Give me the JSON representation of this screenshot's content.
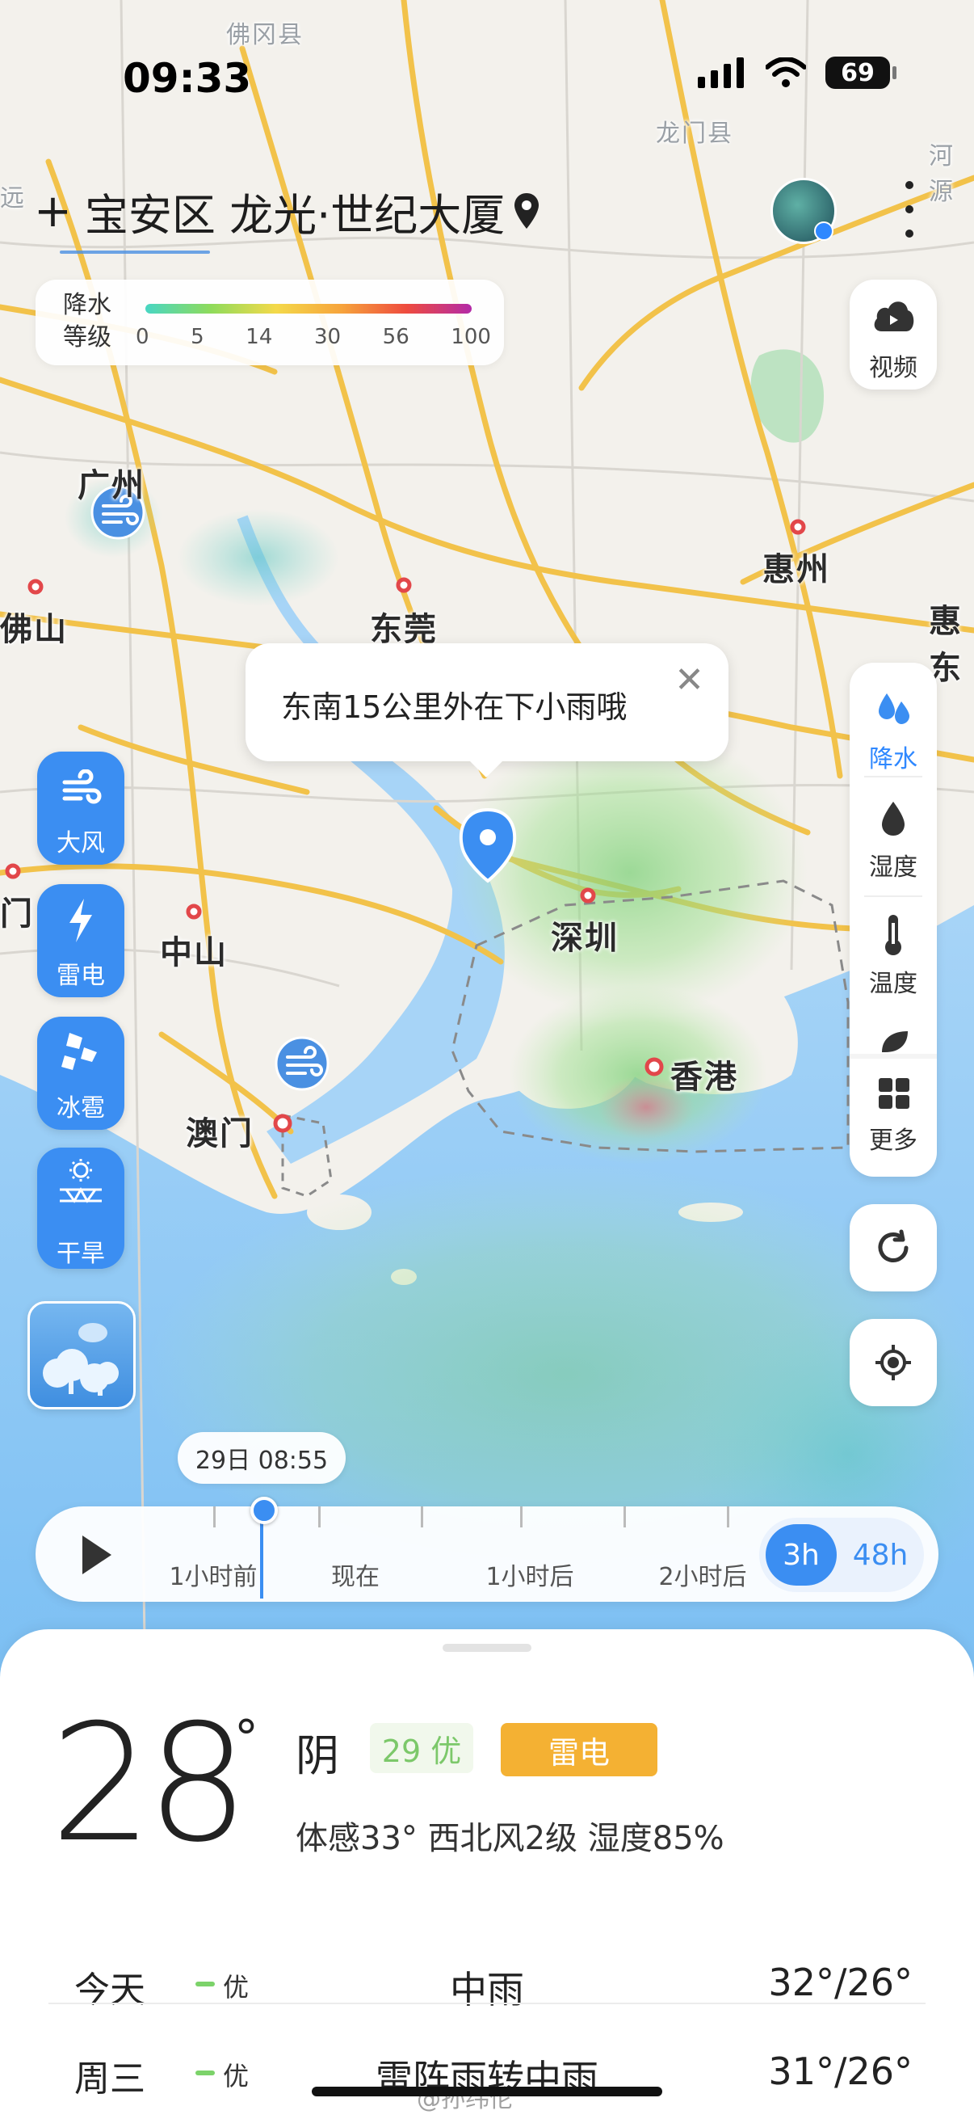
{
  "status_bar": {
    "time": "09:33",
    "battery": "69"
  },
  "header": {
    "location": "宝安区 龙光·世纪大厦"
  },
  "legend": {
    "title": "降水等级",
    "ticks": [
      "0",
      "5",
      "14",
      "30",
      "56",
      "100"
    ]
  },
  "map_labels": {
    "guangzhou": "广州",
    "foshan": "佛山",
    "dongguan": "东莞",
    "huizhou": "惠州",
    "shenzhen": "深圳",
    "zhongshan": "中山",
    "aomen": "澳门",
    "xianggang": "香港",
    "longmen": "龙门县",
    "fogang": "佛冈县",
    "heyuan": "河源",
    "qingyuan": "远",
    "huidong": "惠东",
    "jiangmen": "门"
  },
  "right_panel": {
    "video_label": "视频",
    "layers": [
      {
        "label": "降水",
        "icon": "rain-drops-icon",
        "active": true
      },
      {
        "label": "湿度",
        "icon": "humidity-drop-icon",
        "active": false
      },
      {
        "label": "温度",
        "icon": "thermometer-icon",
        "active": false
      }
    ],
    "more_label": "更多"
  },
  "left_panel": {
    "buttons": [
      {
        "label": "大风",
        "icon": "wind-icon"
      },
      {
        "label": "雷电",
        "icon": "lightning-icon"
      },
      {
        "label": "冰雹",
        "icon": "hail-icon"
      },
      {
        "label": "干旱",
        "icon": "drought-icon"
      }
    ]
  },
  "tooltip": {
    "text": "东南15公里外在下小雨哦"
  },
  "timeline": {
    "current_time": "29日 08:55",
    "labels": [
      "1小时前",
      "现在",
      "1小时后",
      "2小时后"
    ],
    "range_options": [
      "3h",
      "48h"
    ],
    "selected_range": "3h"
  },
  "current": {
    "temp": "28",
    "deg": "°",
    "condition": "阴",
    "aqi": "29 优",
    "alert": "雷电",
    "detail": "体感33° 西北风2级 湿度85%"
  },
  "forecast": [
    {
      "day": "今天",
      "aq": "优",
      "weather": "中雨",
      "range": "32°/26°"
    },
    {
      "day": "周三",
      "aq": "优",
      "weather": "雷阵雨转中雨",
      "range": "31°/26°"
    }
  ],
  "watermark": "@孙纬伦",
  "colors": {
    "accent": "#3b8ef2",
    "alert": "#f4b133",
    "aqi_good": "#7cc86a"
  }
}
